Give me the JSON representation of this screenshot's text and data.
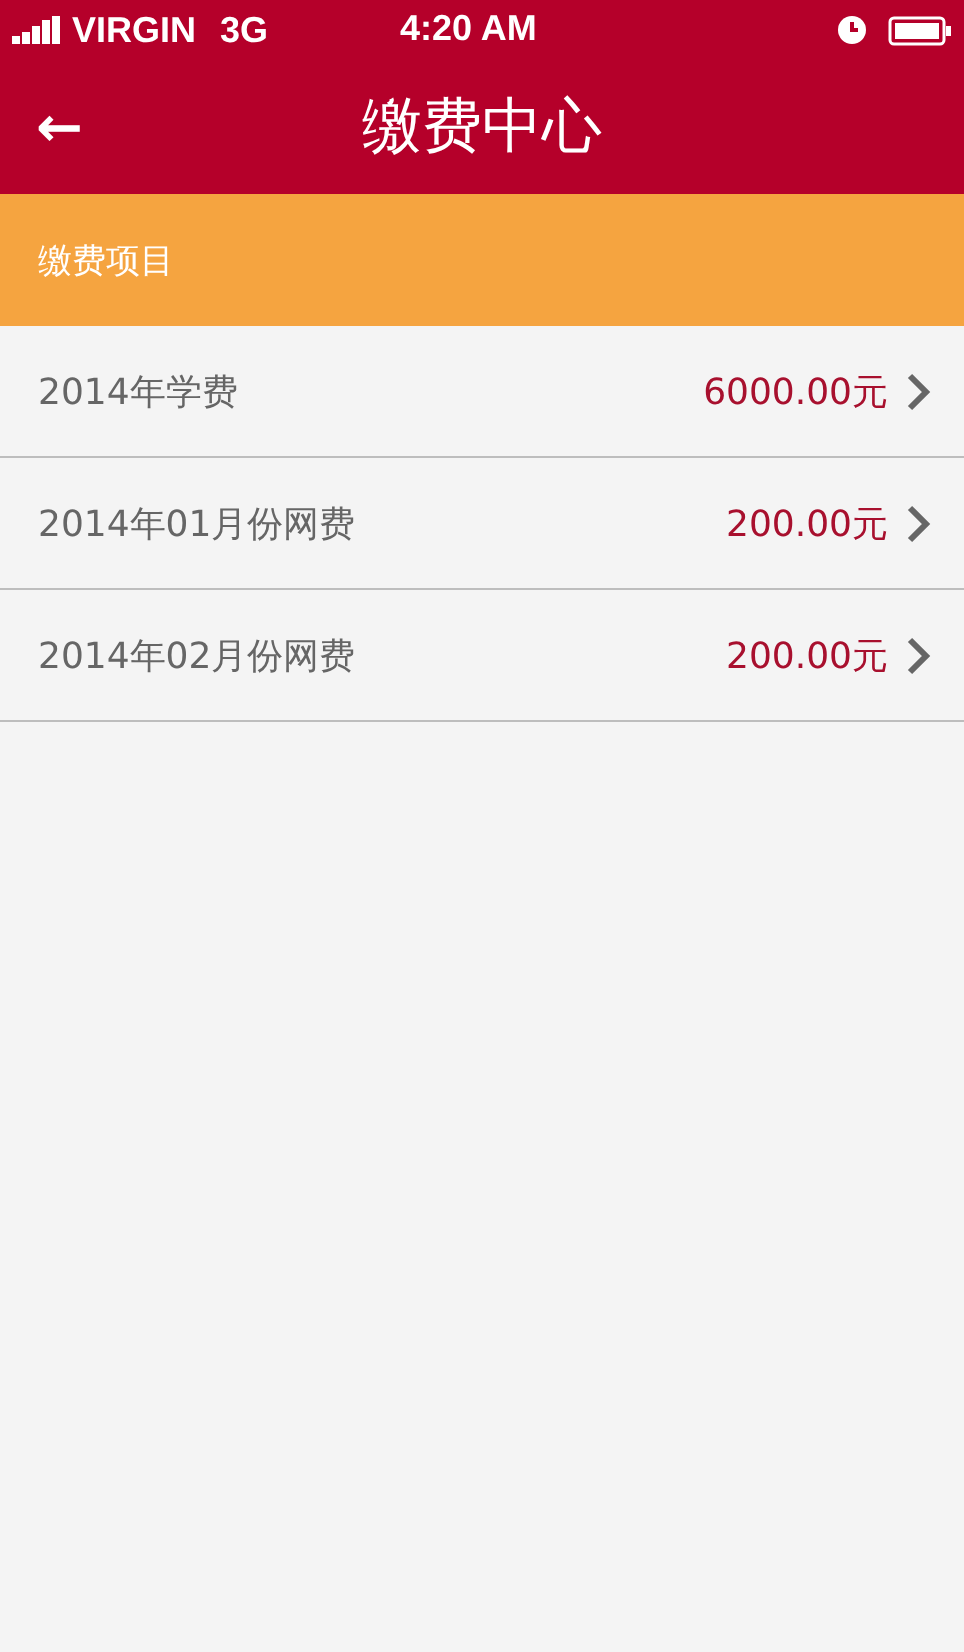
{
  "status_bar": {
    "carrier": "VIRGIN",
    "network": "3G",
    "time": "4:20 AM"
  },
  "header": {
    "back": "←",
    "title": "缴费中心"
  },
  "section": {
    "title": "缴费项目"
  },
  "items": [
    {
      "name": "2014年学费",
      "amount": "6000.00元"
    },
    {
      "name": "2014年01月份网费",
      "amount": "200.00元"
    },
    {
      "name": "2014年02月份网费",
      "amount": "200.00元"
    }
  ]
}
